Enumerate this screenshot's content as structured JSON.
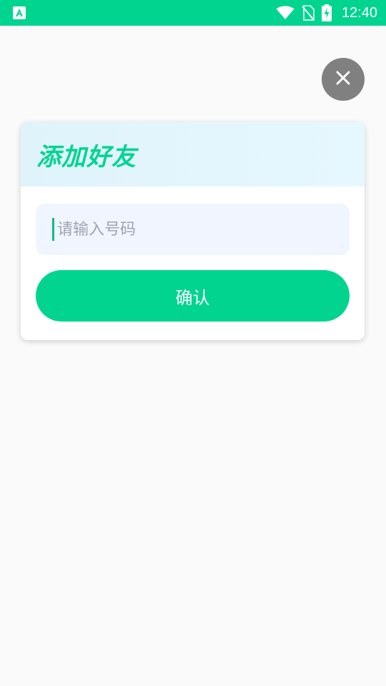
{
  "status_bar": {
    "time": "12:40",
    "background": "#00d48f",
    "icons": [
      "app-notification-icon",
      "wifi-icon",
      "no-sim-icon",
      "battery-charging-icon"
    ]
  },
  "dialog": {
    "title": "添加好友",
    "input": {
      "value": "",
      "placeholder": "请输入号码"
    },
    "confirm_label": "确认",
    "accent_color": "#00d48f"
  },
  "close_icon": "close-icon"
}
